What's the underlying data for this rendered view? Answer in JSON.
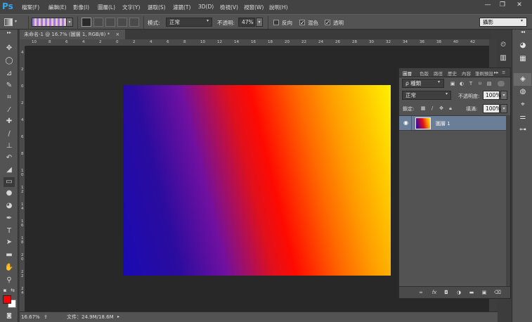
{
  "app": {
    "logo": "Ps"
  },
  "menu": [
    "檔案(F)",
    "編輯(E)",
    "影像(I)",
    "圖層(L)",
    "文字(Y)",
    "選取(S)",
    "濾鏡(T)",
    "3D(D)",
    "檢視(V)",
    "視窗(W)",
    "說明(H)"
  ],
  "window_buttons": {
    "minimize": "—",
    "restore": "❐",
    "close": "✕"
  },
  "options": {
    "mode_label": "模式:",
    "mode_value": "正常",
    "opacity_label": "不透明:",
    "opacity_value": "47%",
    "reverse_label": "反向",
    "dither_label": "混色",
    "transparency_label": "透明",
    "reverse_checked": false,
    "dither_checked": true,
    "transparency_checked": true,
    "workspace": "攝影"
  },
  "document": {
    "tab_title": "未命名-1 @ 16.7% (圖層 1, RGB/8) *",
    "tab_close": "×",
    "ruler_top": [
      "10",
      "8",
      "6",
      "4",
      "2",
      "0",
      "2",
      "4",
      "6",
      "8",
      "10",
      "12",
      "14",
      "16",
      "18",
      "20",
      "22",
      "24",
      "26",
      "28",
      "30",
      "32",
      "34",
      "36",
      "38",
      "40",
      "42"
    ],
    "ruler_left": [
      "4",
      "2",
      "0",
      "2",
      "4",
      "6",
      "8",
      "1\n0",
      "1\n2",
      "1\n4",
      "1\n6",
      "1\n8",
      "2\n0",
      "2\n2",
      "2\n4"
    ],
    "canvas_colors": [
      "#1a0ab4",
      "#e0101c",
      "#ff9e00",
      "#fff000"
    ]
  },
  "status": {
    "zoom": "16.67%",
    "doc_size": "文件：24.9M/18.6M"
  },
  "layers_panel": {
    "tabs": [
      "圖層",
      "色版",
      "路徑",
      "歷史",
      "內容",
      "筆刷預設"
    ],
    "filter_kind": "ρ 種類",
    "blend_mode": "正常",
    "opacity_label": "不透明度:",
    "opacity_value": "100%",
    "lock_label": "鎖定:",
    "fill_label": "填滿:",
    "fill_value": "100%",
    "layer_name": "圖層 1"
  },
  "colors": {
    "foreground": "#ff0000",
    "background": "#ffffff",
    "layer_selected": "#6b7e98",
    "ps_blue": "#3aa4e8"
  }
}
